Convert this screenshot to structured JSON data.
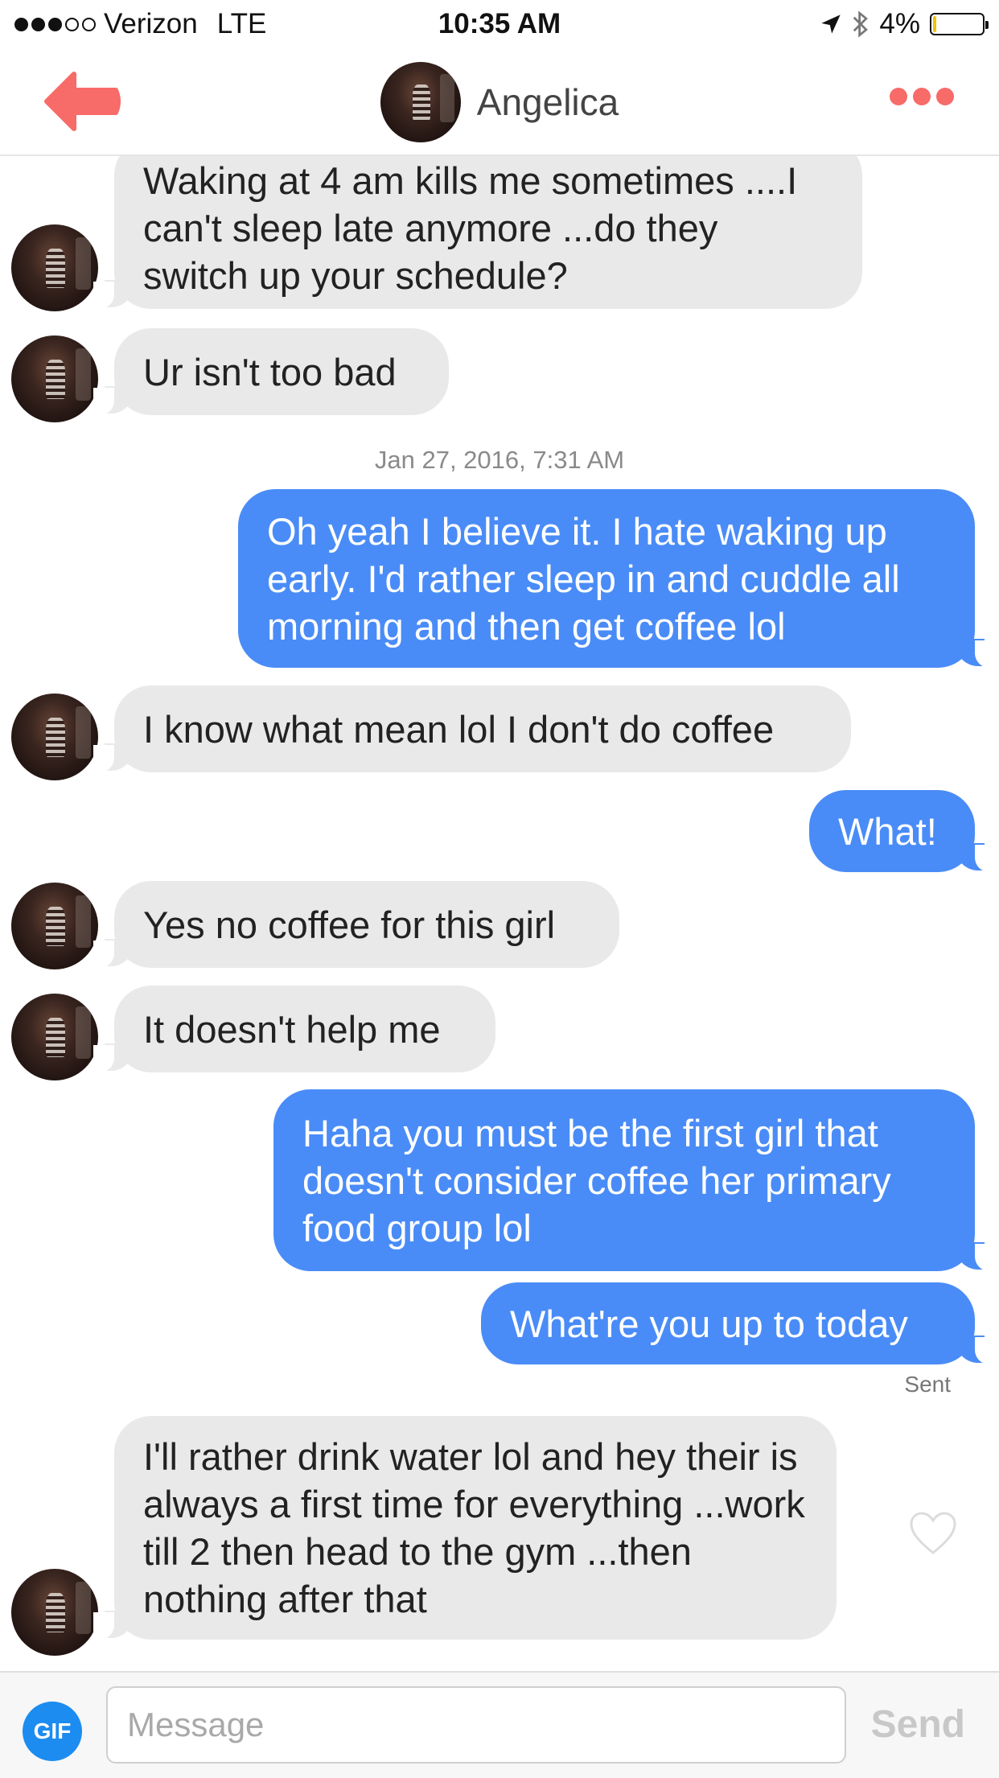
{
  "status_bar": {
    "carrier": "Verizon",
    "network": "LTE",
    "time": "10:35 AM",
    "battery": "4%",
    "battery_level": 0.04,
    "signal_bars_filled": 3,
    "signal_bars_total": 5,
    "icons": [
      "location-arrow-icon",
      "bluetooth-icon",
      "battery-icon"
    ]
  },
  "header": {
    "contact_name": "Angelica",
    "back_icon": "back-arrow-icon",
    "more_icon": "more-dots-icon",
    "accent_color": "#f76b68"
  },
  "messages": [
    {
      "direction": "in",
      "text": "Waking at 4 am kills me sometimes ....I can't sleep late anymore ...do they switch up your schedule?"
    },
    {
      "direction": "in",
      "text": "Ur isn't too bad"
    },
    {
      "timestamp": "Jan 27, 2016, 7:31 AM"
    },
    {
      "direction": "out",
      "text": "Oh yeah I believe it. I hate waking up early. I'd rather sleep in and cuddle all morning and then get coffee lol"
    },
    {
      "direction": "in",
      "text": "I know what mean lol I don't do coffee"
    },
    {
      "direction": "out",
      "text": "What!"
    },
    {
      "direction": "in",
      "text": "Yes no coffee for this girl"
    },
    {
      "direction": "in",
      "text": "It doesn't help me"
    },
    {
      "direction": "out",
      "text": "Haha you must be the first girl that doesn't consider coffee her primary food group lol"
    },
    {
      "direction": "out",
      "text": "What're you up to today",
      "status": "Sent"
    },
    {
      "direction": "in",
      "text": "I'll rather drink water lol and hey their is always a first time for everything ...work till 2 then head to the gym ...then nothing after that",
      "reaction_icon": "heart-outline-icon"
    }
  ],
  "composer": {
    "gif_label": "GIF",
    "placeholder": "Message",
    "value": "",
    "send_label": "Send"
  },
  "colors": {
    "outgoing_bubble": "#4a8cf7",
    "incoming_bubble": "#e9e9ea",
    "gif_button": "#1c8cf0",
    "send_disabled": "#c8c8c8"
  }
}
